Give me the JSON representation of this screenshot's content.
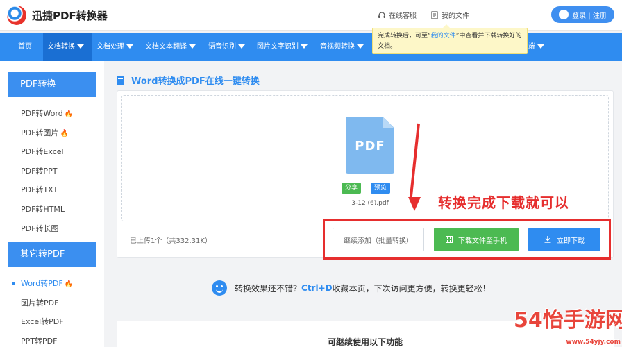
{
  "app": {
    "name": "迅捷PDF转换器"
  },
  "header": {
    "online_service": "在线客服",
    "my_files": "我的文件",
    "login_label": "登录 | 注册"
  },
  "nav": {
    "items": [
      {
        "label": "首页"
      },
      {
        "label": "文档转换"
      },
      {
        "label": "文档处理"
      },
      {
        "label": "文档文本翻译"
      },
      {
        "label": "语音识别"
      },
      {
        "label": "图片文字识别"
      },
      {
        "label": "音视频转换"
      },
      {
        "label": "端"
      }
    ]
  },
  "tooltip": {
    "part1": "完成转换后，可至“",
    "link": "我的文件",
    "part2": "”中查看并下载转换好的文档。"
  },
  "sidebar": {
    "section1_title": "PDF转换",
    "section1_items": [
      {
        "label": "PDF转Word",
        "hot": true
      },
      {
        "label": "PDF转图片",
        "hot": true
      },
      {
        "label": "PDF转Excel",
        "hot": false
      },
      {
        "label": "PDF转PPT",
        "hot": false
      },
      {
        "label": "PDF转TXT",
        "hot": false
      },
      {
        "label": "PDF转HTML",
        "hot": false
      },
      {
        "label": "PDF转长图",
        "hot": false
      }
    ],
    "section2_title": "其它转PDF",
    "section2_items": [
      {
        "label": "Word转PDF",
        "hot": true,
        "active": true
      },
      {
        "label": "图片转PDF",
        "hot": false
      },
      {
        "label": "Excel转PDF",
        "hot": false
      },
      {
        "label": "PPT转PDF",
        "hot": false
      }
    ]
  },
  "main": {
    "title": "Word转换成PDF在线一键转换",
    "file_icon_text": "PDF",
    "share_label": "分享",
    "preview_label": "预览",
    "file_name": "3-12 (6).pdf",
    "uploaded_text": "已上传1个（共332.31K）",
    "add_more_label": "继续添加（批量转换）",
    "download_phone_label": "下载文件至手机",
    "download_now_label": "立即下载"
  },
  "annotation": {
    "text": "转换完成下载就可以"
  },
  "tip": {
    "text1": "转换效果还不错？",
    "shortcut": "Ctrl+D",
    "text2": "收藏本页，下次访问更方便，转换更轻松！"
  },
  "bottom": {
    "title": "可继续使用以下功能"
  },
  "watermark": {
    "text": "54怡手游网",
    "site": "www.54yjy.com"
  },
  "colors": {
    "brand_blue": "#2f8cf0",
    "green": "#4cba52",
    "annotation_red": "#e62e2e"
  }
}
